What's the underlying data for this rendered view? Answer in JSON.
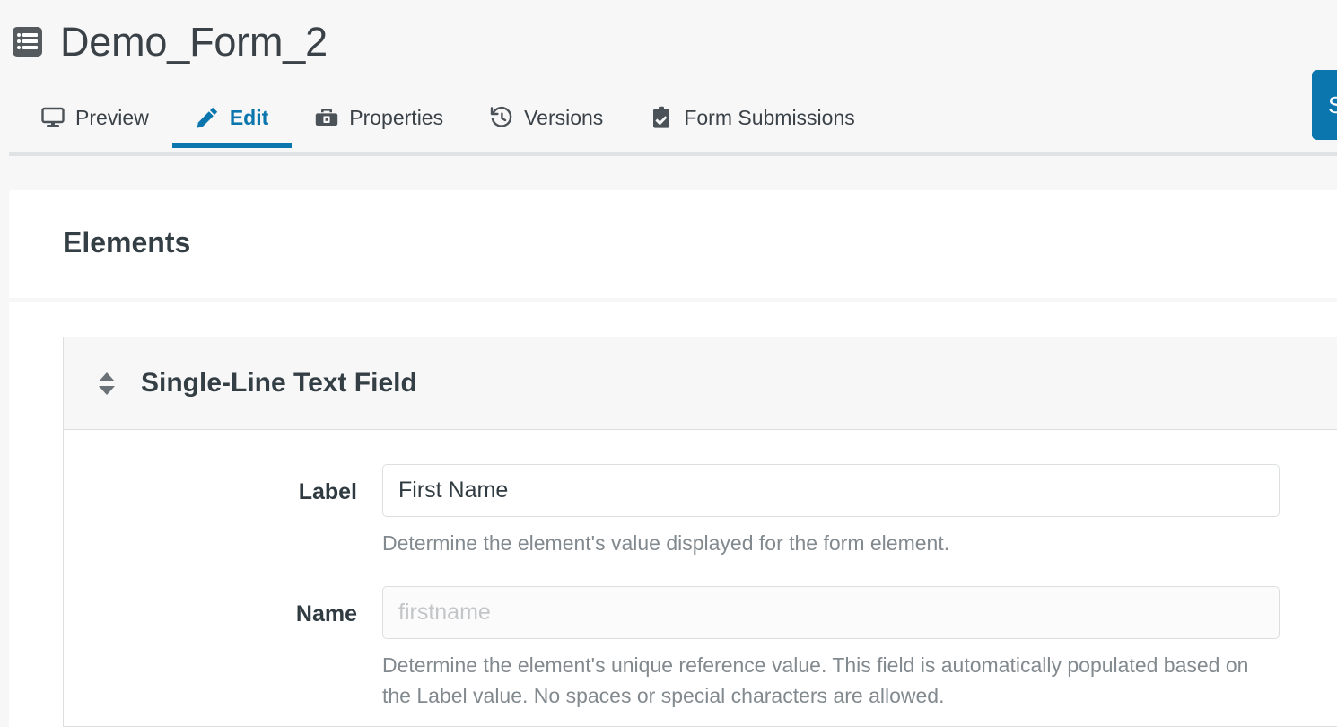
{
  "header": {
    "icon": "form-list-icon",
    "title": "Demo_Form_2"
  },
  "tabs": [
    {
      "id": "preview",
      "label": "Preview",
      "icon": "monitor-icon",
      "active": false
    },
    {
      "id": "edit",
      "label": "Edit",
      "icon": "pencil-icon",
      "active": true
    },
    {
      "id": "properties",
      "label": "Properties",
      "icon": "toolbox-icon",
      "active": false
    },
    {
      "id": "versions",
      "label": "Versions",
      "icon": "history-icon",
      "active": false
    },
    {
      "id": "form-submissions",
      "label": "Form Submissions",
      "icon": "clipboard-check-icon",
      "active": false
    }
  ],
  "toolbar": {
    "save_label": "Save"
  },
  "sections": {
    "elements_heading": "Elements"
  },
  "element": {
    "title": "Single-Line Text Field",
    "sort_handle_icon": "sort-updown-icon",
    "fields": [
      {
        "label": "Label",
        "value": "First Name",
        "placeholder": "",
        "help": "Determine the element's value displayed for the form element."
      },
      {
        "label": "Name",
        "value": "",
        "placeholder": "firstname",
        "help": "Determine the element's unique reference value. This field is automatically populated based on the Label value. No spaces or special characters are allowed."
      }
    ]
  },
  "colors": {
    "accent": "#0b76ad",
    "text": "#343e45",
    "muted": "#828a8f",
    "page_bg": "#f7f7f8",
    "border": "#dcdedf"
  }
}
